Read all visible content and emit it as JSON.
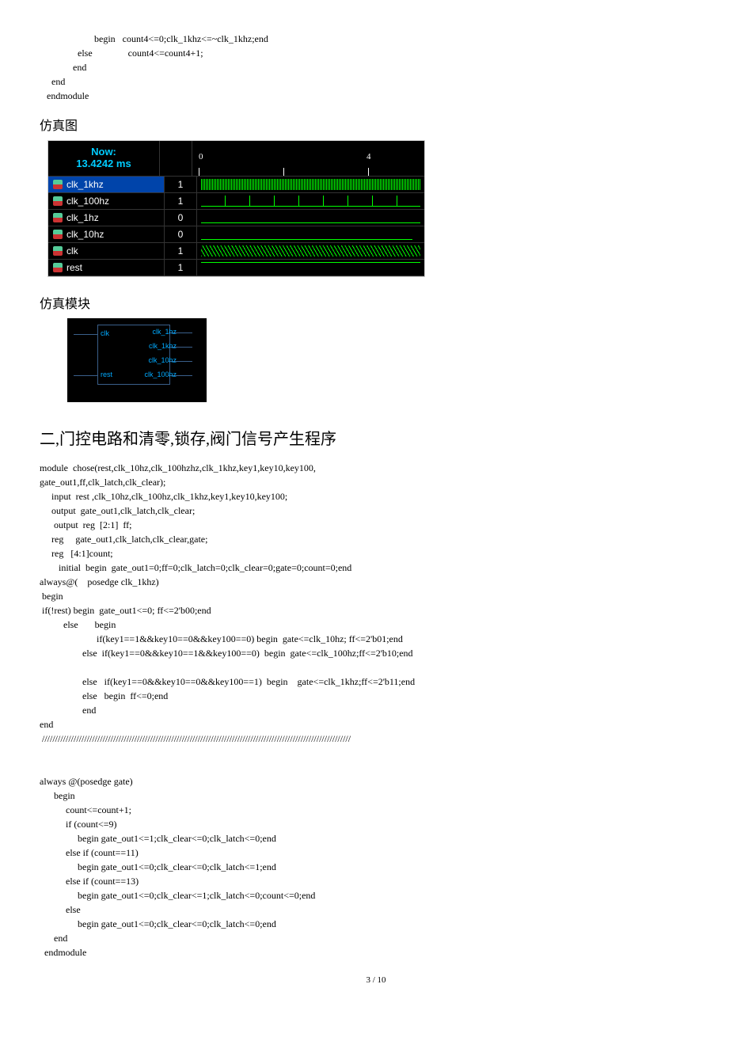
{
  "code_top": "                       begin   count4<=0;clk_1khz<=~clk_1khz;end\n                else               count4<=count4+1;\n              end\n     end\n   endmodule",
  "heading_sim_diagram": "仿真图",
  "wave": {
    "now_label": "Now:",
    "now_time": "13.4242 ms",
    "ticks": [
      "0",
      "4"
    ],
    "rows": [
      {
        "name": "clk_1khz",
        "value": "1",
        "current": true
      },
      {
        "name": "clk_100hz",
        "value": "1"
      },
      {
        "name": "clk_1hz",
        "value": "0"
      },
      {
        "name": "clk_10hz",
        "value": "0"
      },
      {
        "name": "clk",
        "value": "1"
      },
      {
        "name": "rest",
        "value": "1"
      }
    ]
  },
  "heading_sim_block": "仿真模块",
  "block_ports": {
    "clk": "clk",
    "rest": "rest",
    "out1": "clk_1hz",
    "out2": "clk_1khz",
    "out3": "clk_10hz",
    "out4": "clk_100hz"
  },
  "heading_section2": "二,门控电路和清零,锁存,阀门信号产生程序",
  "code_main": "module  chose(rest,clk_10hz,clk_100hzhz,clk_1khz,key1,key10,key100,\ngate_out1,ff,clk_latch,clk_clear);\n     input  rest ,clk_10hz,clk_100hz,clk_1khz,key1,key10,key100;\n     output  gate_out1,clk_latch,clk_clear;\n      output  reg  [2:1]  ff;\n     reg     gate_out1,clk_latch,clk_clear,gate;\n     reg   [4:1]count;\n        initial  begin  gate_out1=0;ff=0;clk_latch=0;clk_clear=0;gate=0;count=0;end\nalways@(    posedge clk_1khz)\n begin\n if(!rest) begin  gate_out1<=0; ff<=2'b00;end\n          else       begin\n                        if(key1==1&&key10==0&&key100==0) begin  gate<=clk_10hz; ff<=2'b01;end\n                  else  if(key1==0&&key10==1&&key100==0)  begin  gate<=clk_100hz;ff<=2'b10;end\n\n                  else   if(key1==0&&key10==0&&key100==1)  begin    gate<=clk_1khz;ff<=2'b11;end\n                  else   begin  ff<=0;end\n                  end\nend\n /////////////////////////////////////////////////////////////////////////////////////////////////////////////////////\n\n\nalways @(posedge gate)\n      begin\n           count<=count+1;\n           if (count<=9)\n                begin gate_out1<=1;clk_clear<=0;clk_latch<=0;end\n           else if (count==11)\n                begin gate_out1<=0;clk_clear<=0;clk_latch<=1;end\n           else if (count==13)\n                begin gate_out1<=0;clk_clear<=1;clk_latch<=0;count<=0;end\n           else\n                begin gate_out1<=0;clk_clear<=0;clk_latch<=0;end\n      end\n  endmodule",
  "footer": "3 / 10"
}
